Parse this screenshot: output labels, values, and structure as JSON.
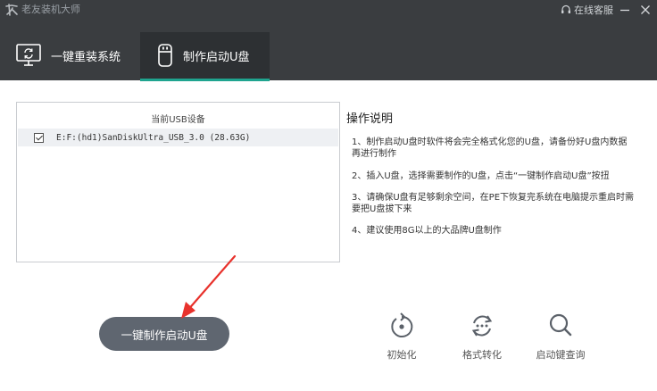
{
  "window": {
    "title": "老友装机大师",
    "support_label": "在线客服"
  },
  "tabs": [
    {
      "label": "一键重装系统",
      "icon": "monitor-refresh-icon",
      "active": false
    },
    {
      "label": "制作启动U盘",
      "icon": "usb-drive-icon",
      "active": true
    }
  ],
  "usb_list": {
    "header": "当前USB设备",
    "devices": [
      {
        "name": "E:F:(hd1)SanDiskUltra_USB_3.0 (28.63G)",
        "checked": true
      }
    ]
  },
  "instructions": {
    "title": "操作说明",
    "items": [
      "1、制作启动U盘时软件将会完全格式化您的U盘，请备份好U盘内数据再进行制作",
      "2、插入U盘，选择需要制作的U盘，点击“一键制作启动U盘”按扭",
      "3、请确保U盘有足够剩余空间，在PE下恢复完系统在电脑提示重启时需要把U盘拔下来",
      "4、建议使用8G以上的大品牌U盘制作"
    ]
  },
  "primary_button": "一键制作启动U盘",
  "tools": [
    {
      "label": "初始化",
      "icon": "reset-icon"
    },
    {
      "label": "格式转化",
      "icon": "convert-icon"
    },
    {
      "label": "启动键查询",
      "icon": "search-icon"
    }
  ],
  "colors": {
    "header_bg": "#3a3d40",
    "active_tab_bg": "#2d3033",
    "accent": "#1fa48f",
    "primary_button_bg": "#5f6670",
    "annotation_arrow": "#e8322c"
  }
}
